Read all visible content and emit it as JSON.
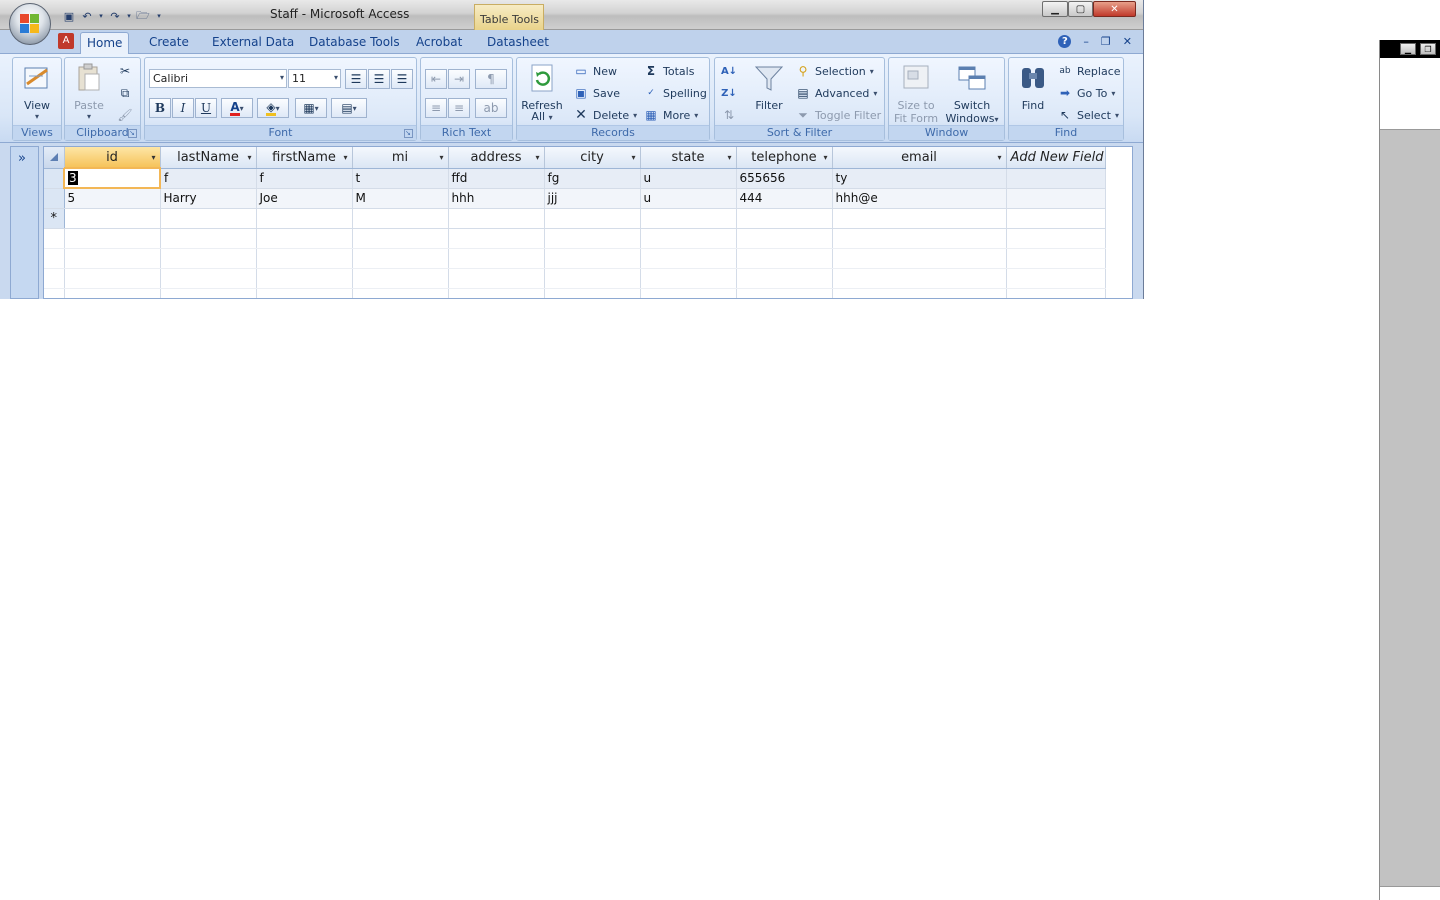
{
  "window": {
    "title": "Staff - Microsoft Access",
    "context_tab": "Table Tools"
  },
  "quick_access": {
    "icons": [
      "save-icon",
      "undo-icon",
      "redo-icon",
      "open-icon",
      "customize-icon"
    ]
  },
  "ribbon_tabs": [
    {
      "label": "Home",
      "active": true
    },
    {
      "label": "Create"
    },
    {
      "label": "External Data"
    },
    {
      "label": "Database Tools"
    },
    {
      "label": "Acrobat"
    },
    {
      "label": "Datasheet"
    }
  ],
  "groups": {
    "views": {
      "label": "Views",
      "view_label": "View"
    },
    "clipboard": {
      "label": "Clipboard",
      "paste_label": "Paste"
    },
    "font": {
      "label": "Font",
      "font_name": "Calibri",
      "font_size": "11",
      "bold": "B",
      "italic": "I",
      "underline": "U"
    },
    "rich_text": {
      "label": "Rich Text"
    },
    "records": {
      "label": "Records",
      "refresh_label_1": "Refresh",
      "refresh_label_2": "All",
      "new_label": "New",
      "save_label": "Save",
      "delete_label": "Delete",
      "totals_label": "Totals",
      "spelling_label": "Spelling",
      "more_label": "More"
    },
    "sort_filter": {
      "label": "Sort & Filter",
      "filter_label": "Filter",
      "selection_label": "Selection",
      "advanced_label": "Advanced",
      "toggle_filter_label": "Toggle Filter"
    },
    "window": {
      "label": "Window",
      "size_to_fit_1": "Size to",
      "size_to_fit_2": "Fit Form",
      "switch_1": "Switch",
      "switch_2": "Windows"
    },
    "find": {
      "label": "Find",
      "find_label": "Find",
      "replace_label": "Replace",
      "goto_label": "Go To",
      "select_label": "Select"
    }
  },
  "datasheet": {
    "columns": [
      "id",
      "lastName",
      "firstName",
      "mi",
      "address",
      "city",
      "state",
      "telephone",
      "email"
    ],
    "add_new_field": "Add New Field",
    "rows": [
      {
        "id": "3",
        "lastName": "f",
        "firstName": "f",
        "mi": "t",
        "address": "ffd",
        "city": "fg",
        "state": "u",
        "telephone": "655656",
        "email": "ty"
      },
      {
        "id": "5",
        "lastName": "Harry",
        "firstName": "Joe",
        "mi": "M",
        "address": "hhh",
        "city": "jjj",
        "state": "u",
        "telephone": "444",
        "email": "hhh@e"
      }
    ],
    "new_row_marker": "*"
  },
  "colors": {
    "ribbon_text": "#15428b",
    "selected_header": "#f6c35b",
    "accent": "#2f62b8"
  }
}
